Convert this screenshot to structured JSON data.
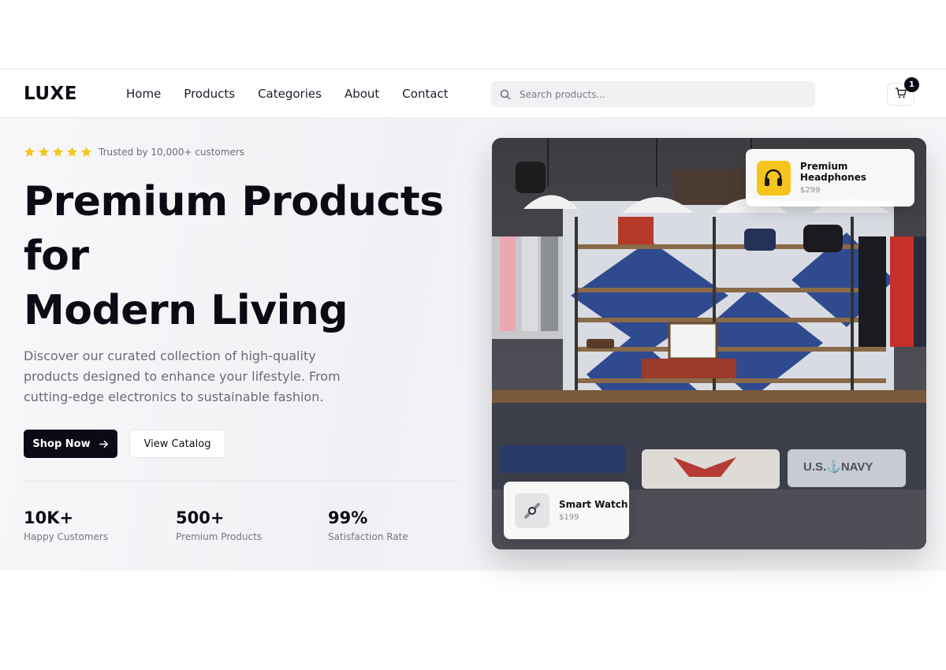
{
  "brand": {
    "logo": "LUXE"
  },
  "nav": {
    "items": [
      "Home",
      "Products",
      "Categories",
      "About",
      "Contact"
    ]
  },
  "search": {
    "placeholder": "Search products..."
  },
  "cart": {
    "count": "1",
    "icon": "cart-icon"
  },
  "hero": {
    "rating_text": "Trusted by 10,000+ customers",
    "stars": 5,
    "star_color": "#f5c518",
    "headline": [
      "Premium Products",
      "for",
      "Modern Living"
    ],
    "description": "Discover our curated collection of high-quality products designed to enhance your lifestyle. From cutting-edge electronics to sustainable fashion.",
    "primary_button": "Shop Now",
    "secondary_button": "View Catalog"
  },
  "stats": [
    {
      "value": "10K+",
      "label": "Happy Customers"
    },
    {
      "value": "500+",
      "label": "Premium Products"
    },
    {
      "value": "99%",
      "label": "Satisfaction Rate"
    }
  ],
  "featured": [
    {
      "name": "Premium Headphones",
      "price": "$299",
      "icon": "headphones-icon"
    },
    {
      "name": "Smart Watch",
      "price": "$199",
      "icon": "watch-icon"
    }
  ],
  "colors": {
    "primary": "#0b0b18",
    "accent": "#f5c518"
  }
}
